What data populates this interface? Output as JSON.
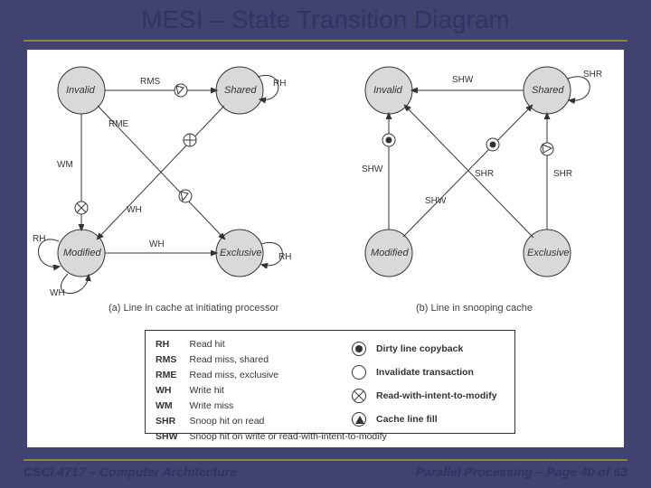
{
  "title": "MESI – State Transition Diagram",
  "footer_left": "CSCI 4717 – Computer Architecture",
  "footer_right": "Parallel Processing – Page 40 of 63",
  "panels": {
    "a": {
      "caption": "(a) Line in cache at initiating processor"
    },
    "b": {
      "caption": "(b) Line in snooping cache"
    }
  },
  "states": [
    "Invalid",
    "Shared",
    "Modified",
    "Exclusive"
  ],
  "edge_labels_a": {
    "inv_sh": "RMS",
    "sh_sh": "RH",
    "inv_mod": "WM",
    "inv_exc": "RME",
    "sh_mod": "WH",
    "mod_mod_rh": "RH",
    "mod_mod_wh": "WH",
    "mod_exc": "WH",
    "exc_mod": "WH",
    "exc_exc": "RH"
  },
  "edge_labels_b": {
    "sh_inv": "SHW",
    "exc_sh": "SHR",
    "mod_sh": "SHR",
    "mod_inv": "SHW",
    "exc_inv": "SHW",
    "sh_sh": "SHR"
  },
  "legend_left": [
    {
      "k": "RH",
      "v": "Read hit"
    },
    {
      "k": "RMS",
      "v": "Read miss, shared"
    },
    {
      "k": "RME",
      "v": "Read miss, exclusive"
    },
    {
      "k": "WH",
      "v": "Write hit"
    },
    {
      "k": "WM",
      "v": "Write miss"
    },
    {
      "k": "SHR",
      "v": "Snoop hit on read"
    },
    {
      "k": "SHW",
      "v": "Snoop hit on write or read-with-intent-to-modify"
    }
  ],
  "legend_right": [
    {
      "sym": "dot",
      "v": "Dirty line copyback"
    },
    {
      "sym": "open",
      "v": "Invalidate transaction"
    },
    {
      "sym": "cross",
      "v": "Read-with-intent-to-modify"
    },
    {
      "sym": "tri",
      "v": "Cache line fill"
    }
  ]
}
